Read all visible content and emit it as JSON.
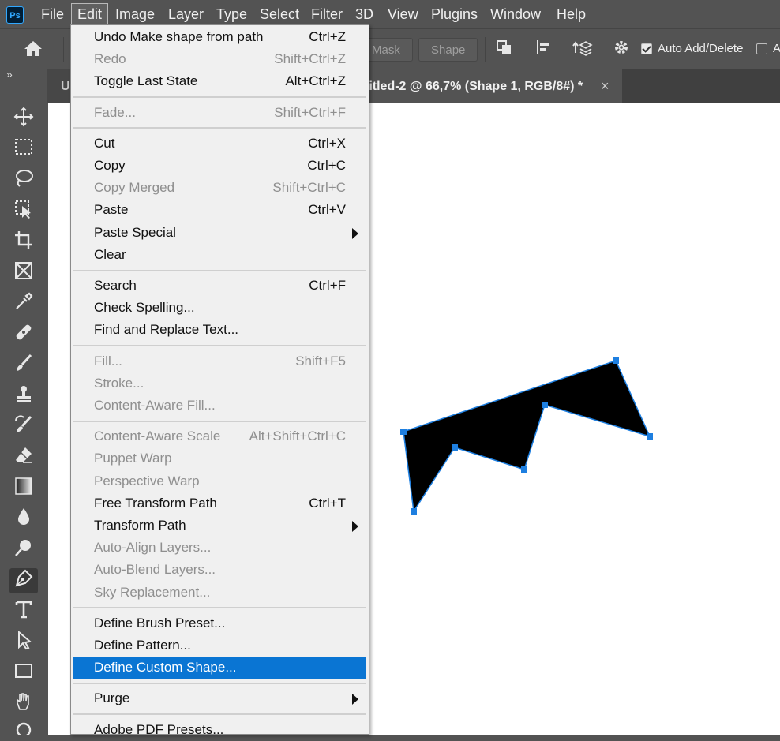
{
  "app": {
    "logo": "Ps"
  },
  "menubar": [
    "File",
    "Edit",
    "Image",
    "Layer",
    "Type",
    "Select",
    "Filter",
    "3D",
    "View",
    "Plugins",
    "Window",
    "Help"
  ],
  "options_bar": {
    "mask_label": "Mask",
    "shape_label": "Shape",
    "auto_add_delete_label": "Auto Add/Delete",
    "auto_add_delete_checked": true,
    "align_edges_partial": "A"
  },
  "toolbar_collapse": "»",
  "document_tabs": [
    {
      "label": "U"
    },
    {
      "label": "titled-2 @ 66,7% (Shape 1, RGB/8#) *",
      "active": true,
      "close": "×"
    }
  ],
  "edit_menu": {
    "groups": [
      [
        {
          "label": "Undo Make shape from path",
          "shortcut": "Ctrl+Z",
          "enabled": true
        },
        {
          "label": "Redo",
          "shortcut": "Shift+Ctrl+Z",
          "enabled": false
        },
        {
          "label": "Toggle Last State",
          "shortcut": "Alt+Ctrl+Z",
          "enabled": true
        }
      ],
      [
        {
          "label": "Fade...",
          "shortcut": "Shift+Ctrl+F",
          "enabled": false
        }
      ],
      [
        {
          "label": "Cut",
          "shortcut": "Ctrl+X",
          "enabled": true
        },
        {
          "label": "Copy",
          "shortcut": "Ctrl+C",
          "enabled": true
        },
        {
          "label": "Copy Merged",
          "shortcut": "Shift+Ctrl+C",
          "enabled": false
        },
        {
          "label": "Paste",
          "shortcut": "Ctrl+V",
          "enabled": true
        },
        {
          "label": "Paste Special",
          "shortcut": "",
          "enabled": true,
          "submenu": true
        },
        {
          "label": "Clear",
          "shortcut": "",
          "enabled": true
        }
      ],
      [
        {
          "label": "Search",
          "shortcut": "Ctrl+F",
          "enabled": true
        },
        {
          "label": "Check Spelling...",
          "shortcut": "",
          "enabled": true
        },
        {
          "label": "Find and Replace Text...",
          "shortcut": "",
          "enabled": true
        }
      ],
      [
        {
          "label": "Fill...",
          "shortcut": "Shift+F5",
          "enabled": false
        },
        {
          "label": "Stroke...",
          "shortcut": "",
          "enabled": false
        },
        {
          "label": "Content-Aware Fill...",
          "shortcut": "",
          "enabled": false
        }
      ],
      [
        {
          "label": "Content-Aware Scale",
          "shortcut": "Alt+Shift+Ctrl+C",
          "enabled": false
        },
        {
          "label": "Puppet Warp",
          "shortcut": "",
          "enabled": false
        },
        {
          "label": "Perspective Warp",
          "shortcut": "",
          "enabled": false
        },
        {
          "label": "Free Transform Path",
          "shortcut": "Ctrl+T",
          "enabled": true
        },
        {
          "label": "Transform Path",
          "shortcut": "",
          "enabled": true,
          "submenu": true
        },
        {
          "label": "Auto-Align Layers...",
          "shortcut": "",
          "enabled": false
        },
        {
          "label": "Auto-Blend Layers...",
          "shortcut": "",
          "enabled": false
        },
        {
          "label": "Sky Replacement...",
          "shortcut": "",
          "enabled": false
        }
      ],
      [
        {
          "label": "Define Brush Preset...",
          "shortcut": "",
          "enabled": true
        },
        {
          "label": "Define Pattern...",
          "shortcut": "",
          "enabled": true
        },
        {
          "label": "Define Custom Shape...",
          "shortcut": "",
          "enabled": true,
          "highlighted": true
        }
      ],
      [
        {
          "label": "Purge",
          "shortcut": "",
          "enabled": true,
          "submenu": true
        }
      ],
      [
        {
          "label": "Adobe PDF Presets...",
          "shortcut": "",
          "enabled": true
        }
      ]
    ]
  },
  "colors": {
    "highlight": "#0a75d3",
    "path_anchor": "#1e7fe0",
    "shape_fill": "#000000"
  }
}
